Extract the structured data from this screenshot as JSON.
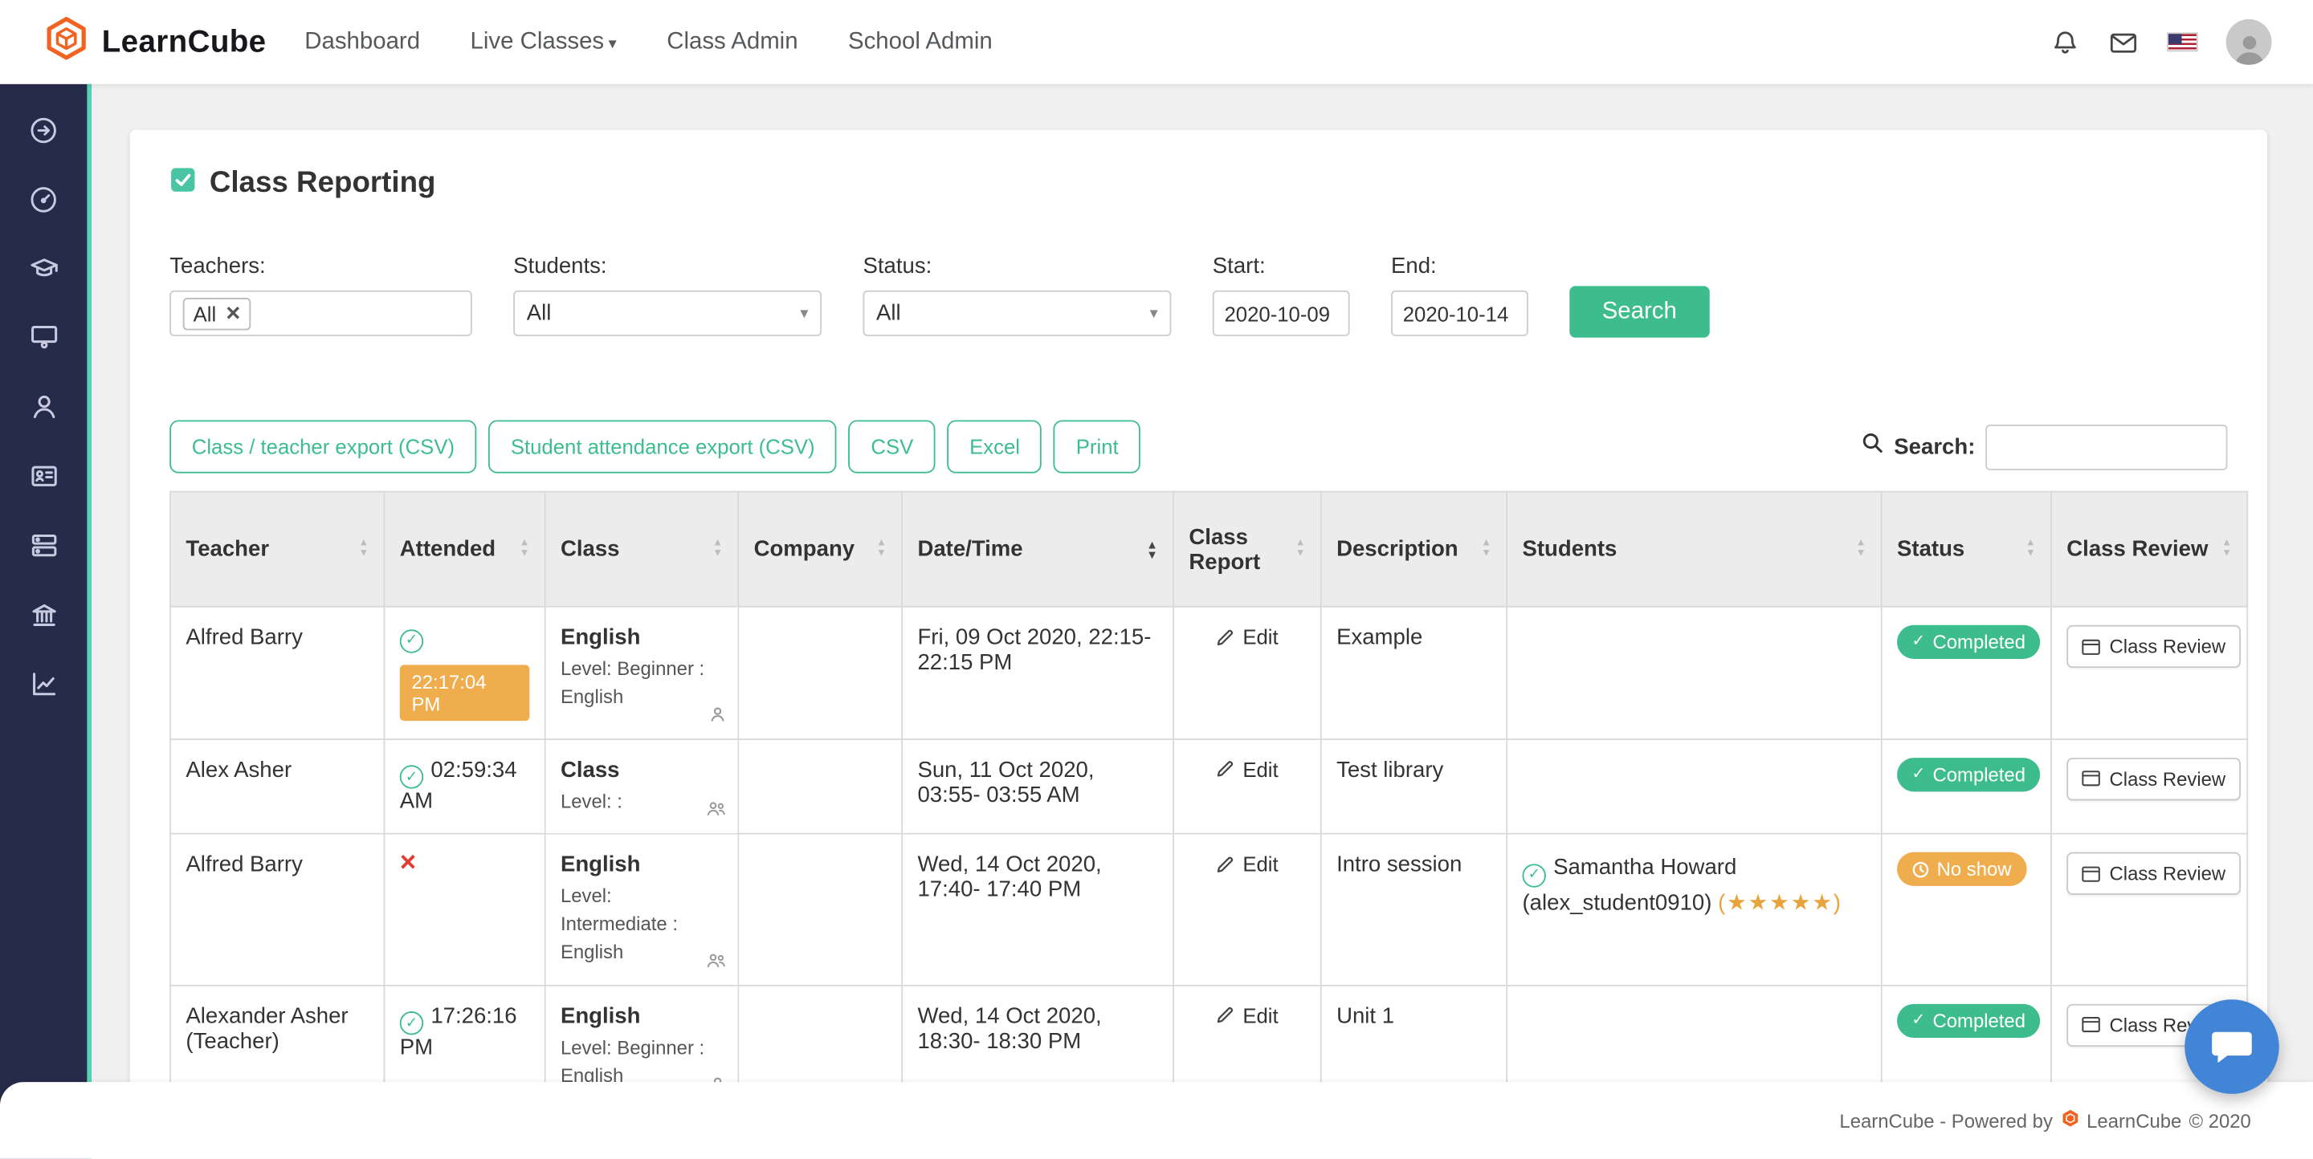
{
  "navbar": {
    "brand": "LearnCube",
    "links": [
      {
        "label": "Dashboard"
      },
      {
        "label": "Live Classes"
      },
      {
        "label": "Class Admin"
      },
      {
        "label": "School Admin"
      }
    ]
  },
  "page": {
    "title": "Class Reporting"
  },
  "filters": {
    "teachers": {
      "label": "Teachers:",
      "value": "All"
    },
    "students": {
      "label": "Students:",
      "value": "All"
    },
    "status": {
      "label": "Status:",
      "value": "All"
    },
    "start": {
      "label": "Start:",
      "value": "2020-10-09"
    },
    "end": {
      "label": "End:",
      "value": "2020-10-14"
    },
    "search_button": "Search"
  },
  "toolbar": {
    "export_class_teacher": "Class / teacher export (CSV)",
    "export_attendance": "Student attendance export (CSV)",
    "csv": "CSV",
    "excel": "Excel",
    "print": "Print",
    "search_label": "Search:"
  },
  "table": {
    "headers": [
      "Teacher",
      "Attended",
      "Class",
      "Company",
      "Date/Time",
      "Class Report",
      "Description",
      "Students",
      "Status",
      "Class Review"
    ],
    "edit_label": "Edit",
    "review_label": "Class Review",
    "rows": [
      {
        "teacher": "Alfred Barry",
        "attended_time": "22:17:04 PM",
        "class_title": "English",
        "class_level": "Level: Beginner : English",
        "datetime": "Fri, 09 Oct 2020, 22:15- 22:15 PM",
        "description": "Example",
        "status": "Completed"
      },
      {
        "teacher": "Alex Asher",
        "attended_time": "02:59:34 AM",
        "class_title": "Class",
        "class_level": "Level: :",
        "datetime": "Sun, 11 Oct 2020, 03:55- 03:55 AM",
        "description": "Test library",
        "status": "Completed"
      },
      {
        "teacher": "Alfred Barry",
        "class_title": "English",
        "class_level": "Level: Intermediate : English",
        "datetime": "Wed, 14 Oct 2020, 17:40- 17:40 PM",
        "description": "Intro session",
        "student_name": "Samantha Howard (alex_student0910)",
        "student_stars": "(★★★★★)",
        "status": "No show"
      },
      {
        "teacher": "Alexander Asher (Teacher)",
        "attended_time": "17:26:16 PM",
        "class_title": "English",
        "class_level": "Level: Beginner : English",
        "datetime": "Wed, 14 Oct 2020, 18:30- 18:30 PM",
        "description": "Unit 1",
        "status": "Completed"
      }
    ]
  },
  "footer": {
    "powered_by": "LearnCube - Powered by",
    "brand": "LearnCube",
    "year": "© 2020"
  }
}
